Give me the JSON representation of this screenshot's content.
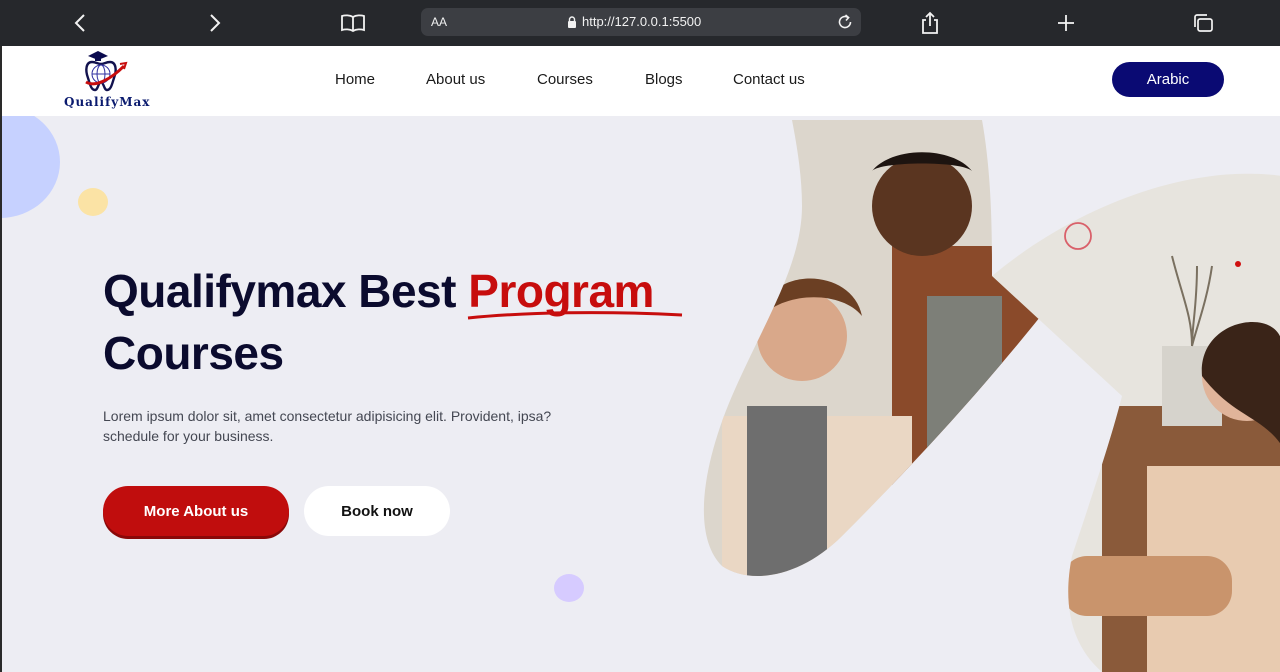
{
  "browser": {
    "aa_label": "AA",
    "url": "http://127.0.0.1:5500"
  },
  "header": {
    "logo_text": "QualifyMax",
    "nav": [
      {
        "label": "Home"
      },
      {
        "label": "About us"
      },
      {
        "label": "Courses"
      },
      {
        "label": "Blogs"
      },
      {
        "label": "Contact us"
      }
    ],
    "language_button": "Arabic"
  },
  "hero": {
    "title_part1": "Qualifymax Best ",
    "title_accent": "Program",
    "title_line2": "Courses",
    "description_line1": "Lorem ipsum dolor sit, amet consectetur adipisicing elit. Provident, ipsa?",
    "description_line2": "schedule for your business.",
    "primary_button": "More About us",
    "secondary_button": "Book now"
  },
  "colors": {
    "accent_red": "#c70d0d",
    "navy": "#0a0a73",
    "hero_bg": "#ededf3",
    "toolbar_bg": "#26282c"
  },
  "icons": [
    "back-arrow-icon",
    "forward-arrow-icon",
    "reader-book-icon",
    "lock-icon",
    "reload-icon",
    "share-icon",
    "new-tab-plus-icon",
    "tabs-overview-icon",
    "logo-tooth-globe-icon"
  ]
}
